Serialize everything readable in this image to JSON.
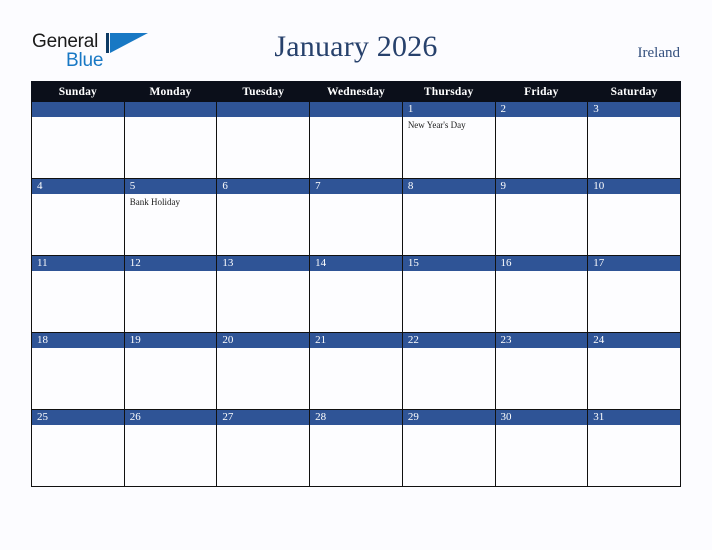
{
  "header": {
    "logo": {
      "line1": "General",
      "line2": "Blue",
      "mark": "triangle-logo-mark"
    },
    "title": "January 2026",
    "country": "Ireland"
  },
  "calendar": {
    "weekday_headers": [
      "Sunday",
      "Monday",
      "Tuesday",
      "Wednesday",
      "Thursday",
      "Friday",
      "Saturday"
    ],
    "colors": {
      "header_row": "#0b0f1a",
      "day_bar": "#2f5496",
      "cell_background": "#fdfdff",
      "grid_line": "#111111",
      "title_text": "#27416c",
      "country_text": "#34507e",
      "logo_blue": "#1878c4"
    },
    "weeks": [
      [
        {
          "day": "",
          "events": []
        },
        {
          "day": "",
          "events": []
        },
        {
          "day": "",
          "events": []
        },
        {
          "day": "",
          "events": []
        },
        {
          "day": "1",
          "events": [
            "New Year's Day"
          ]
        },
        {
          "day": "2",
          "events": []
        },
        {
          "day": "3",
          "events": []
        }
      ],
      [
        {
          "day": "4",
          "events": []
        },
        {
          "day": "5",
          "events": [
            "Bank Holiday"
          ]
        },
        {
          "day": "6",
          "events": []
        },
        {
          "day": "7",
          "events": []
        },
        {
          "day": "8",
          "events": []
        },
        {
          "day": "9",
          "events": []
        },
        {
          "day": "10",
          "events": []
        }
      ],
      [
        {
          "day": "11",
          "events": []
        },
        {
          "day": "12",
          "events": []
        },
        {
          "day": "13",
          "events": []
        },
        {
          "day": "14",
          "events": []
        },
        {
          "day": "15",
          "events": []
        },
        {
          "day": "16",
          "events": []
        },
        {
          "day": "17",
          "events": []
        }
      ],
      [
        {
          "day": "18",
          "events": []
        },
        {
          "day": "19",
          "events": []
        },
        {
          "day": "20",
          "events": []
        },
        {
          "day": "21",
          "events": []
        },
        {
          "day": "22",
          "events": []
        },
        {
          "day": "23",
          "events": []
        },
        {
          "day": "24",
          "events": []
        }
      ],
      [
        {
          "day": "25",
          "events": []
        },
        {
          "day": "26",
          "events": []
        },
        {
          "day": "27",
          "events": []
        },
        {
          "day": "28",
          "events": []
        },
        {
          "day": "29",
          "events": []
        },
        {
          "day": "30",
          "events": []
        },
        {
          "day": "31",
          "events": []
        }
      ]
    ]
  }
}
